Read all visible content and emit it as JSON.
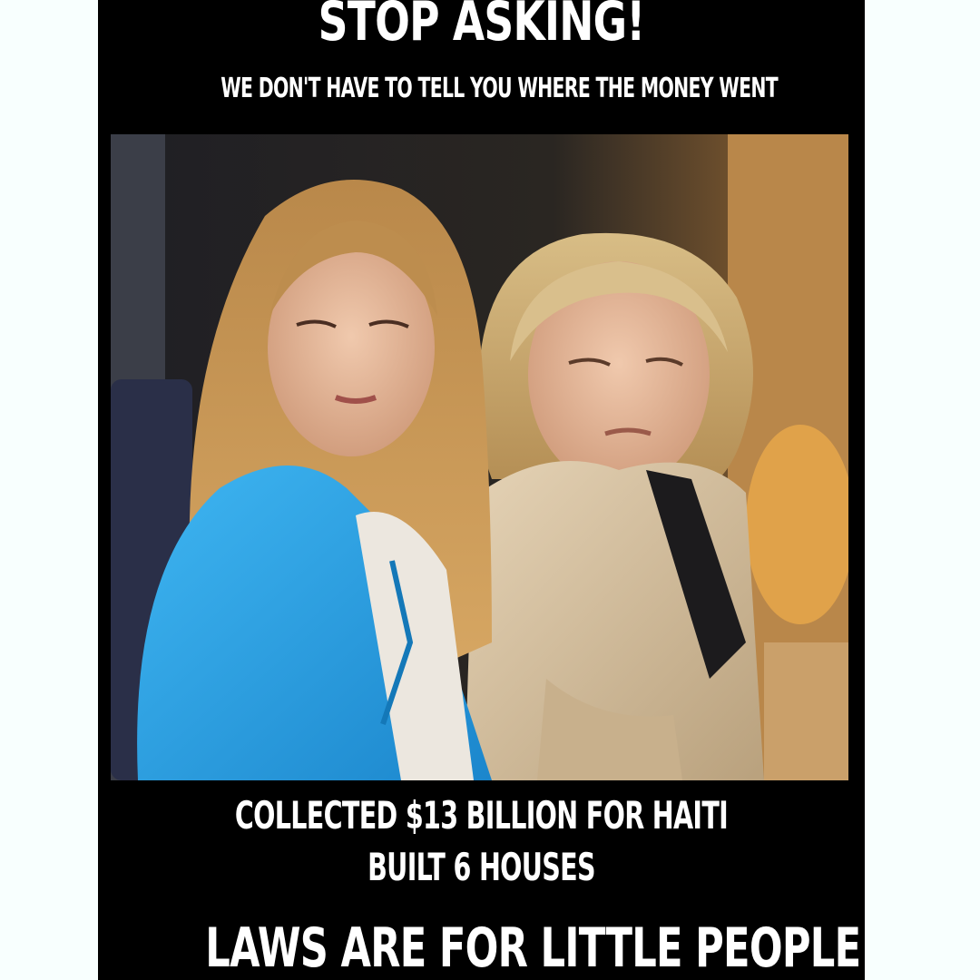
{
  "meme": {
    "headline": "STOP ASKING!",
    "subline": "WE DON'T HAVE TO TELL YOU WHERE THE MONEY WENT",
    "caption_line1": "COLLECTED $13 BILLION FOR HAITI",
    "caption_line2": "BUILT 6 HOUSES",
    "bottom_line": "LAWS ARE FOR LITTLE PEOPLE"
  },
  "colors": {
    "background": "#f8fffe",
    "poster": "#000000",
    "text": "#ffffff",
    "blue_jacket": "#1f9fe3",
    "tan_jacket": "#d9c6a6",
    "blonde_hair": "#c99a55",
    "skin": "#e6b99b"
  }
}
